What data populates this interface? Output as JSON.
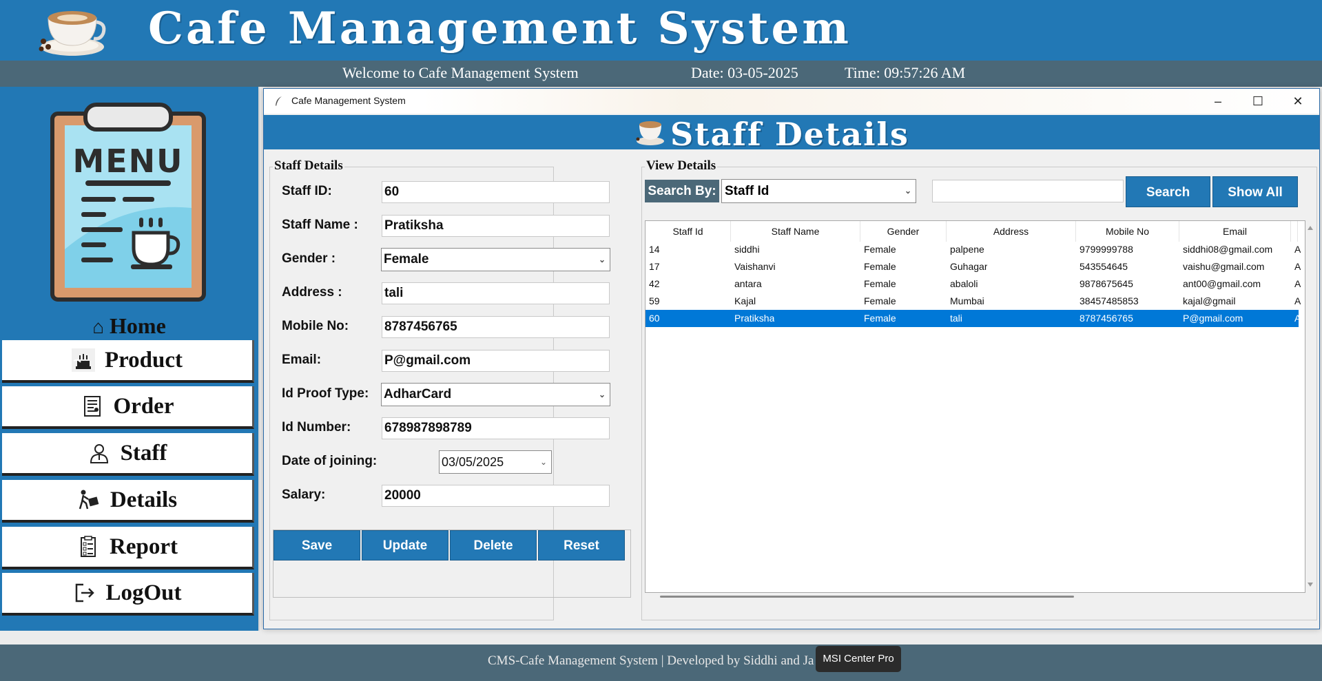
{
  "header": {
    "title": "Cafe Management System",
    "welcome": "Welcome to Cafe Management System",
    "date": "Date: 03-05-2025",
    "time": "Time: 09:57:26 AM"
  },
  "sidebar": {
    "home_label": "Home",
    "items": [
      {
        "label": "Product",
        "icon": "cake-icon"
      },
      {
        "label": "Order",
        "icon": "bill-icon"
      },
      {
        "label": "Staff",
        "icon": "user-icon"
      },
      {
        "label": "Details",
        "icon": "delivery-icon"
      },
      {
        "label": "Report",
        "icon": "checklist-icon"
      },
      {
        "label": "LogOut",
        "icon": "logout-icon"
      }
    ]
  },
  "window": {
    "title": "Cafe Management System",
    "banner": "Staff Details"
  },
  "form": {
    "legend": "Staff Details",
    "staff_id_label": "Staff ID:",
    "staff_id": "60",
    "staff_name_label": "Staff Name :",
    "staff_name": "Pratiksha",
    "gender_label": "Gender :",
    "gender": "Female",
    "address_label": "Address :",
    "address": "tali",
    "mobile_label": "Mobile No:",
    "mobile": "8787456765",
    "email_label": "Email:",
    "email": "P@gmail.com",
    "idproof_label": "Id Proof Type:",
    "idproof": "AdharCard",
    "idnumber_label": "Id Number:",
    "idnumber": "678987898789",
    "doj_label": "Date of joining:",
    "doj": "03/05/2025",
    "salary_label": "Salary:",
    "salary": "20000",
    "buttons": {
      "save": "Save",
      "update": "Update",
      "delete": "Delete",
      "reset": "Reset"
    }
  },
  "view": {
    "legend": "View Details",
    "search_by_label": "Search By:",
    "search_by_value": "Staff Id",
    "search_value": "",
    "search_button": "Search",
    "show_all_button": "Show All",
    "columns": [
      "Staff Id",
      "Staff Name",
      "Gender",
      "Address",
      "Mobile No",
      "Email"
    ],
    "rows": [
      [
        "14",
        "siddhi",
        "Female",
        "palpene",
        "9799999788",
        "siddhi08@gmail.com"
      ],
      [
        "17",
        "Vaishanvi",
        "Female",
        "Guhagar",
        "543554645",
        "vaishu@gmail.com"
      ],
      [
        "42",
        "antara",
        "Female",
        "abaloli",
        "9878675645",
        "ant00@gmail.com"
      ],
      [
        "59",
        "Kajal",
        "Female",
        "Mumbai",
        "38457485853",
        "kajal@gmail"
      ],
      [
        "60",
        "Pratiksha",
        "Female",
        "tali",
        "8787456765",
        "P@gmail.com"
      ]
    ],
    "selected_row": 4
  },
  "footer": {
    "text": "CMS-Cafe Management System | Developed by Siddhi and Ja",
    "tooltip": "MSI Center Pro"
  },
  "colors": {
    "brand_blue": "#2278b5",
    "slate": "#4b6878",
    "selection": "#0078d7"
  }
}
